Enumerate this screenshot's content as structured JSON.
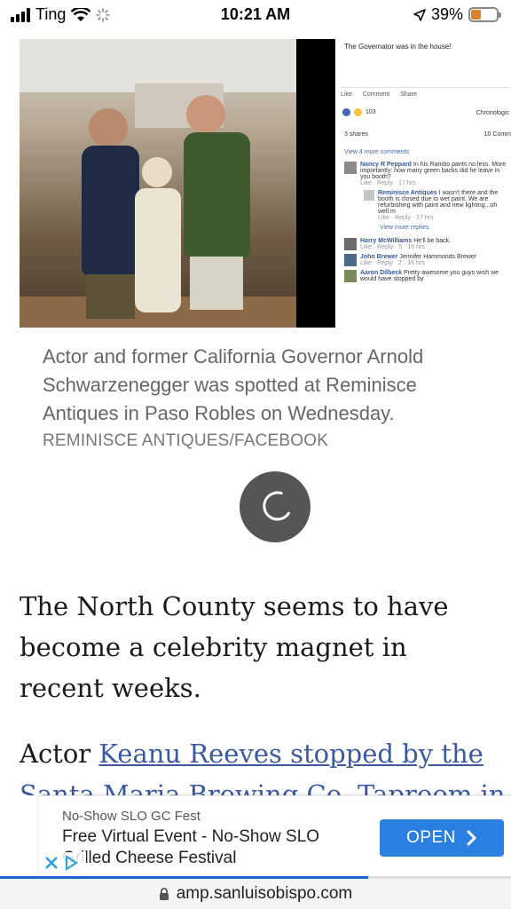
{
  "status_bar": {
    "carrier": "Ting",
    "time": "10:21 AM",
    "battery_percent": "39%",
    "battery_level": 0.39
  },
  "photo": {
    "fb_post_text": "The Governator was in the house!",
    "fb_actions": [
      "Like",
      "Comment",
      "Share"
    ],
    "fb_reaction_count": "103",
    "fb_sort": "Chronologic",
    "fb_shares": "3 shares",
    "fb_comments_count": "10 Comm",
    "fb_view_more": "View 4 more comments",
    "fb_comments": [
      {
        "name": "Nancy R Peppard",
        "text": "In his Rambo pants no less. More importantly: how many green backs did he leave in you booth?",
        "meta": "Like · Reply · 17 hrs"
      },
      {
        "name": "Reminisce Antiques",
        "text": "I wasn't there and the booth is closed due to wet paint. We are refurbishing with paint and new lighting...oh well.m",
        "meta": "Like · Reply · 17 hrs"
      },
      {
        "name": "",
        "text": "View more replies",
        "meta": ""
      },
      {
        "name": "Harry McWilliams",
        "text": "He'll be back.",
        "meta": "Like · Reply · 5 · 16 hrs"
      },
      {
        "name": "John Brewer",
        "text": "Jennifer Hammonds Brewer",
        "meta": "Like · Reply · 2 · 16 hrs"
      },
      {
        "name": "Aaron Dilbeck",
        "text": "Pretty awesome you guys wish we would have stopped by",
        "meta": ""
      }
    ]
  },
  "caption": {
    "text": "Actor and former California Governor Arnold Schwarzenegger was spotted at Reminisce Antiques in Paso Robles on Wednesday.",
    "credit": "REMINISCE ANTIQUES/FACEBOOK"
  },
  "article": {
    "p1": "The North County seems to have become a celebrity magnet in recent weeks.",
    "p2_prefix": "Actor ",
    "p2_link": "Keanu Reeves stopped by the",
    "p3_link": "Santa Maria Brewing Co. Taproom in"
  },
  "ad": {
    "source": "No-Show SLO GC Fest",
    "title": "Free Virtual Event - No-Show SLO Grilled Cheese Festival",
    "button": "OPEN"
  },
  "browser": {
    "url": "amp.sanluisobispo.com",
    "load_progress": 0.72
  },
  "colors": {
    "link": "#3b5a9d",
    "ad_button": "#2a7fe0",
    "progress": "#1a66d2",
    "battery": "#d9822b"
  }
}
